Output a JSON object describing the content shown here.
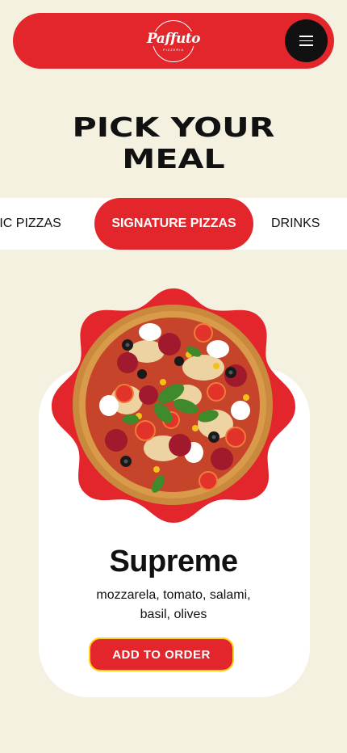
{
  "header": {
    "logo_text": "Paffuto",
    "logo_subtext": "PIZZERIA",
    "menu_icon": "hamburger-menu-icon"
  },
  "page": {
    "title_line1": "PICK YOUR",
    "title_line2": "MEAL"
  },
  "tabs": [
    {
      "label": "SSIC PIZZAS",
      "active": false
    },
    {
      "label": "SIGNATURE PIZZAS",
      "active": true
    },
    {
      "label": "DRINKS",
      "active": false
    }
  ],
  "item": {
    "name": "Supreme",
    "description": "mozzarela, tomato, salami, basil, olives",
    "add_label": "ADD TO ORDER",
    "image": "pizza-image"
  },
  "colors": {
    "background": "#f4f1e1",
    "brand_red": "#e3262b",
    "accent_yellow": "#ffd21f",
    "dark": "#111111"
  }
}
